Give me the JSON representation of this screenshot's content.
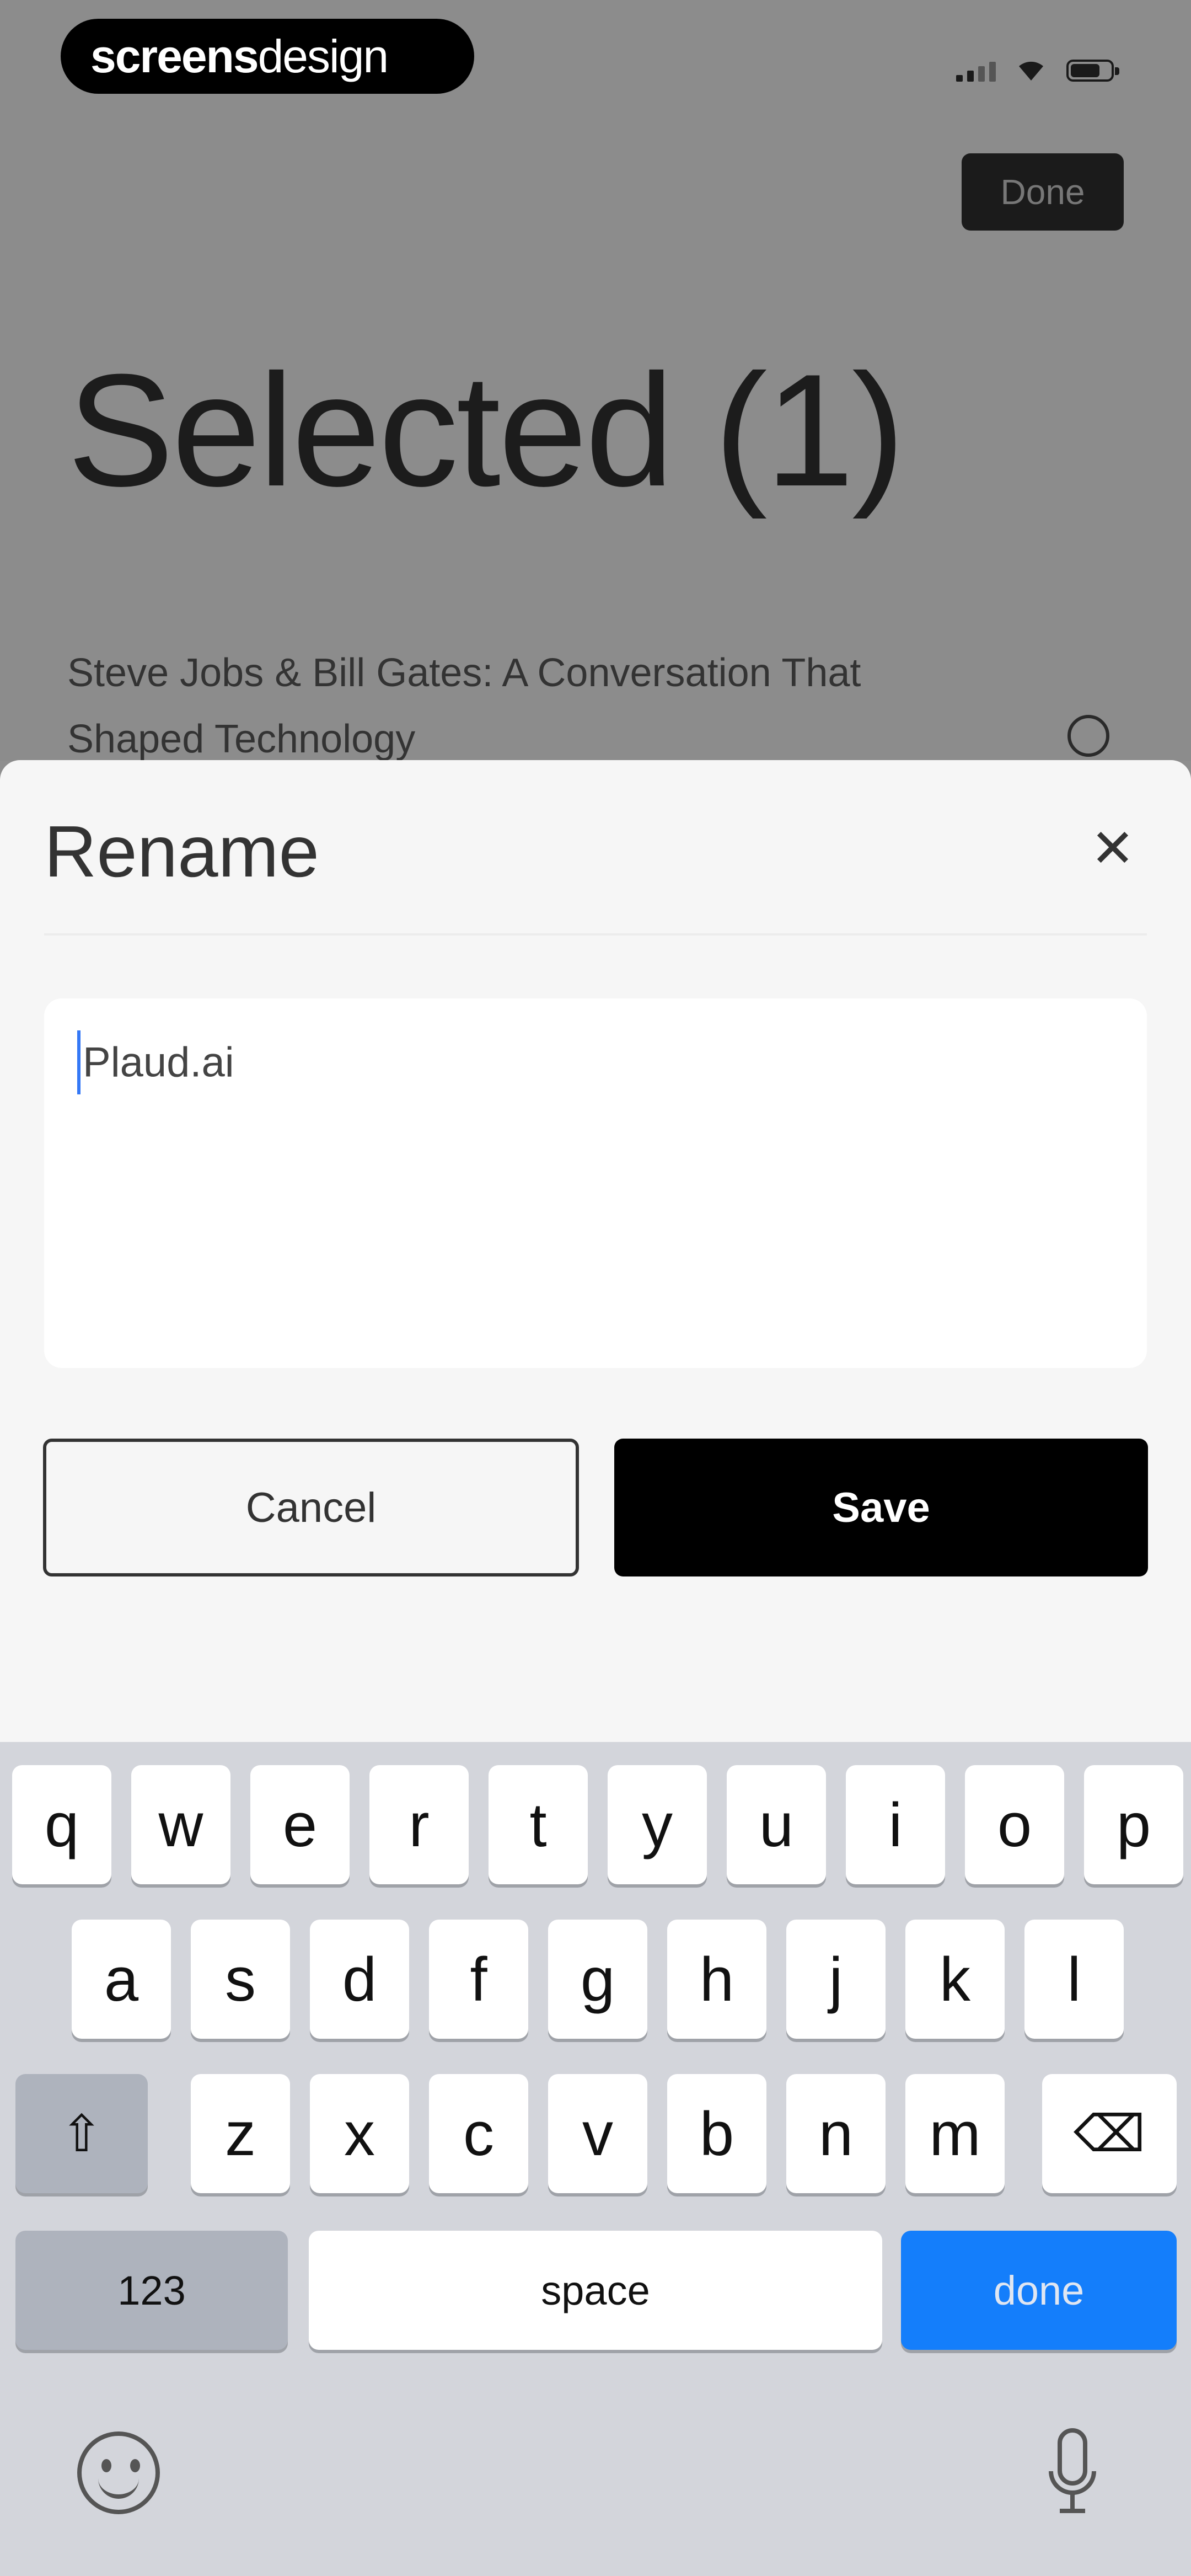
{
  "status_bar": {
    "logo_bold": "screens",
    "logo_light": "design",
    "icons": [
      "signal-icon",
      "wifi-icon",
      "battery-icon"
    ]
  },
  "header": {
    "done_label": "Done",
    "title": "Selected (1)"
  },
  "list": {
    "items": [
      {
        "title": "Steve Jobs & Bill Gates: A Conversation That Shaped Technology"
      }
    ]
  },
  "rename_sheet": {
    "title": "Rename",
    "close_icon": "close-icon",
    "field_value": "Plaud.ai",
    "cancel_label": "Cancel",
    "save_label": "Save",
    "colors": {
      "save_bg": "#000000",
      "caret": "#3478f6"
    }
  },
  "keyboard": {
    "row1": [
      "q",
      "w",
      "e",
      "r",
      "t",
      "y",
      "u",
      "i",
      "o",
      "p"
    ],
    "row2": [
      "a",
      "s",
      "d",
      "f",
      "g",
      "h",
      "j",
      "k",
      "l"
    ],
    "row3": [
      "z",
      "x",
      "c",
      "v",
      "b",
      "n",
      "m"
    ],
    "shift_icon": "shift-icon",
    "delete_icon": "delete-icon",
    "numbers_label": "123",
    "space_label": "space",
    "done_label": "done",
    "emoji_icon": "emoji-icon",
    "mic_icon": "microphone-icon",
    "colors": {
      "done_bg": "#147efb",
      "board_bg": "#d3d5db"
    }
  }
}
